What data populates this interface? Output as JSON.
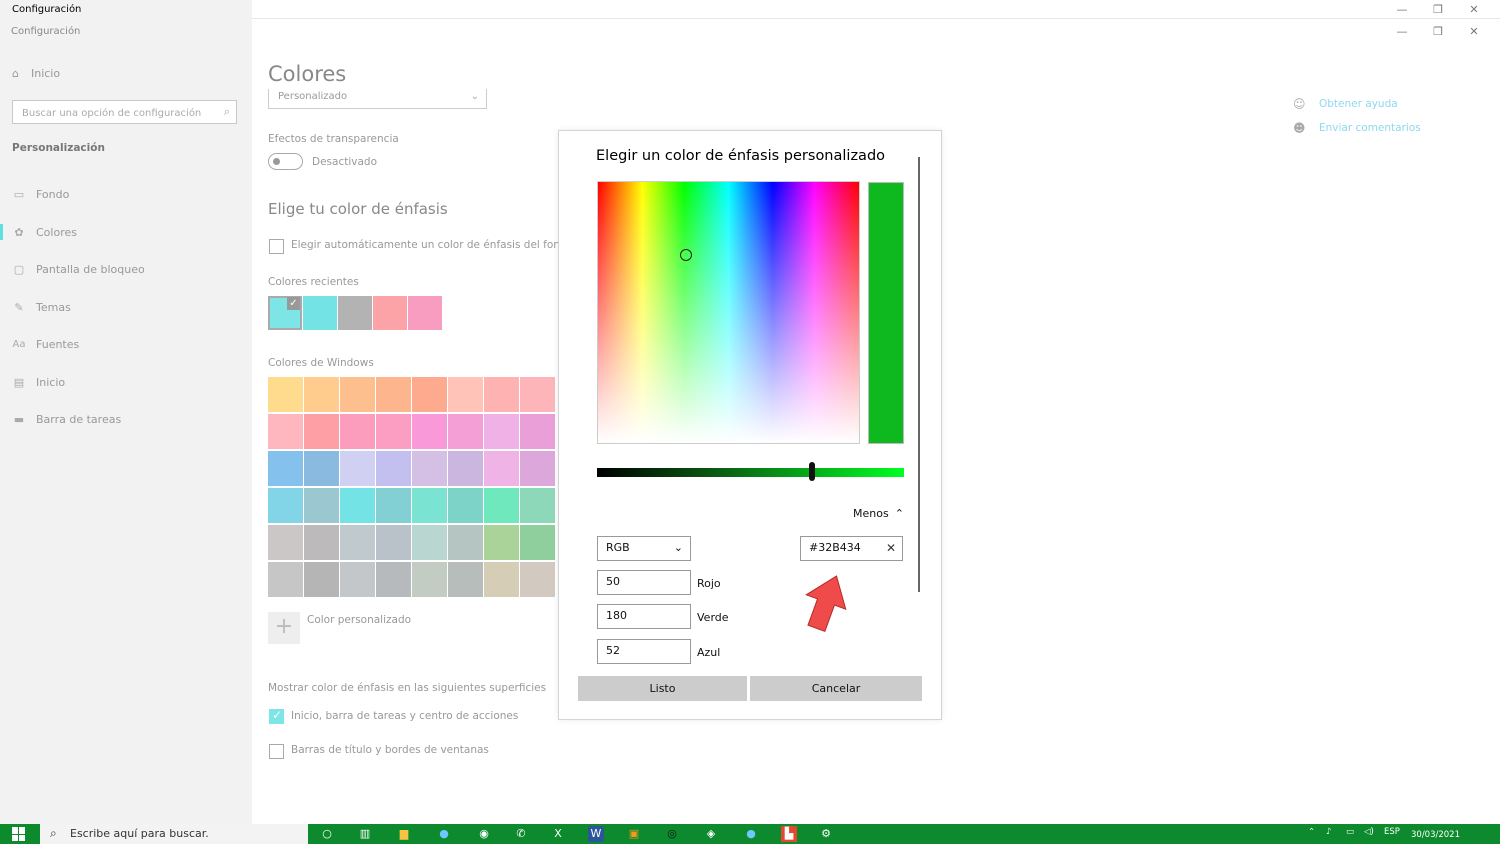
{
  "window": {
    "outer_title": "Configuración",
    "app_title": "Configuración",
    "controls": [
      "—",
      "❐",
      "✕"
    ]
  },
  "sidebar": {
    "home_label": "Inicio",
    "search_placeholder": "Buscar una opción de configuración",
    "section_title": "Personalización",
    "items": [
      {
        "label": "Fondo",
        "icon": "image-icon"
      },
      {
        "label": "Colores",
        "icon": "palette-icon",
        "active": true
      },
      {
        "label": "Pantalla de bloqueo",
        "icon": "lock-screen-icon"
      },
      {
        "label": "Temas",
        "icon": "theme-icon"
      },
      {
        "label": "Fuentes",
        "icon": "font-icon"
      },
      {
        "label": "Inicio",
        "icon": "start-icon"
      },
      {
        "label": "Barra de tareas",
        "icon": "taskbar-icon"
      }
    ]
  },
  "main": {
    "title": "Colores",
    "mode_value": "Personalizado",
    "transparency_label": "Efectos de transparencia",
    "transparency_state": "Desactivado",
    "accent_heading": "Elige tu color de énfasis",
    "auto_accent_label": "Elegir automáticamente un color de énfasis del fondo",
    "recent_label": "Colores recientes",
    "recent_colors": [
      "#7de5e5",
      "#74e3e6",
      "#b3b3b3",
      "#fba3a6",
      "#f89cc0"
    ],
    "windows_label": "Colores de Windows",
    "windows_colors": [
      "#ffdb8e",
      "#ffcc8e",
      "#fdbf8e",
      "#fdb58e",
      "#fdaa8e",
      "#ffc3b7",
      "#ffb2b2",
      "#fdb5b9",
      "#feb6bf",
      "#fe9fa6",
      "#fd9dbe",
      "#fb9ec2",
      "#f999d9",
      "#f49fd6",
      "#f0b2e6",
      "#eb9fd8",
      "#84c2ed",
      "#8bbae0",
      "#d0d0f2",
      "#c3c0f0",
      "#d4c0e4",
      "#cab6de",
      "#f0b3e6",
      "#dca8dc",
      "#82d5e6",
      "#9bc7d1",
      "#74e3e6",
      "#82d0d3",
      "#7ae3d2",
      "#7ed3c8",
      "#6fe8be",
      "#8cd8b9",
      "#cbc7c7",
      "#bcbaba",
      "#c0c9ce",
      "#b9c2c8",
      "#b9d6d1",
      "#b5c6c2",
      "#aad39a",
      "#8fcf9e",
      "#c6c6c6",
      "#b5b5b5",
      "#c3c7c9",
      "#b6babd",
      "#c3ccc3",
      "#b7bdbb",
      "#d6cdb6",
      "#d2cac0"
    ],
    "custom_label": "Color personalizado",
    "surfaces_label": "Mostrar color de énfasis en las siguientes superficies",
    "surface_start_label": "Inicio, barra de tareas y centro de acciones",
    "surface_titlebars_label": "Barras de título y bordes de ventanas"
  },
  "help": {
    "get_help": "Obtener ayuda",
    "feedback": "Enviar comentarios"
  },
  "dialog": {
    "title": "Elegir un color de énfasis personalizado",
    "preview_color": "#0db91f",
    "less_label": "Menos",
    "mode_select": "RGB",
    "hex_value": "#32B434",
    "red_value": "50",
    "red_label": "Rojo",
    "green_value": "180",
    "green_label": "Verde",
    "blue_value": "52",
    "blue_label": "Azul",
    "ok_label": "Listo",
    "cancel_label": "Cancelar"
  },
  "taskbar": {
    "search_placeholder": "Escribe aquí para buscar.",
    "language": "ESP",
    "date": "30/03/2021"
  }
}
